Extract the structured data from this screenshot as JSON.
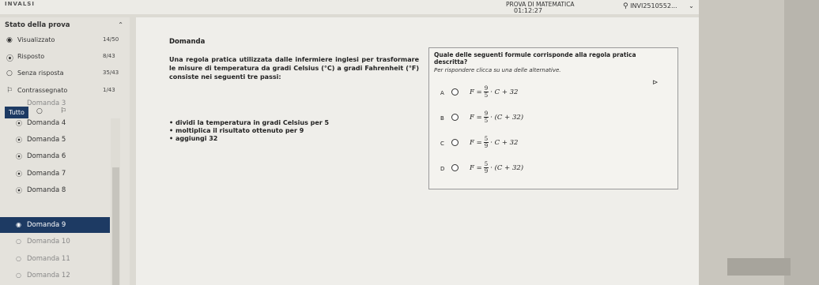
{
  "topbar": {
    "logo": "INVALSI",
    "exam": "PROVA DI MATEMATICA",
    "timer": "01:12:27",
    "user": "INVI2510552..."
  },
  "sidebar": {
    "header": "Stato della prova",
    "stats": [
      {
        "icon": "◉",
        "label": "Visualizzato",
        "count": "14/50"
      },
      {
        "icon": "⦿",
        "label": "Risposto",
        "count": "8/43"
      },
      {
        "icon": "○",
        "label": "Senza risposta",
        "count": "35/43"
      },
      {
        "icon": "⚐",
        "label": "Contrassegnato",
        "count": "1/43"
      }
    ],
    "filter": {
      "all": "Tutto",
      "unanswered": "○",
      "flagged": "⚐"
    },
    "questions": [
      {
        "label": "Domanda 3",
        "icon": "⦿"
      },
      {
        "label": "Domanda 4",
        "icon": "⦿"
      },
      {
        "label": "Domanda 5",
        "icon": "⦿"
      },
      {
        "label": "Domanda 6",
        "icon": "⦿"
      },
      {
        "label": "Domanda 7",
        "icon": "⦿"
      },
      {
        "label": "Domanda 8",
        "icon": "⦿"
      },
      {
        "label": "Domanda 9",
        "icon": "◉"
      },
      {
        "label": "Domanda 10",
        "icon": "○"
      },
      {
        "label": "Domanda 11",
        "icon": "○"
      },
      {
        "label": "Domanda 12",
        "icon": "○"
      }
    ]
  },
  "question": {
    "title": "Domanda",
    "text": "Una regola pratica utilizzata dalle infermiere inglesi per trasformare le misure di temperatura da gradi Celsius (°C) a gradi Fahrenheit (°F) consiste nei seguenti tre passi:",
    "steps": [
      "dividi la temperatura in gradi Celsius per 5",
      "moltiplica il risultato ottenuto per 9",
      "aggiungi 32"
    ]
  },
  "answer": {
    "prompt": "Quale delle seguenti formule corrisponde alla regola pratica descritta?",
    "instruction": "Per rispondere clicca su una delle alternative.",
    "options": [
      {
        "letter": "A",
        "lhs": "F =",
        "num": "9",
        "den": "5",
        "rhs": "· C + 32"
      },
      {
        "letter": "B",
        "lhs": "F =",
        "num": "9",
        "den": "5",
        "rhs": "· (C + 32)"
      },
      {
        "letter": "C",
        "lhs": "F =",
        "num": "5",
        "den": "9",
        "rhs": "· C + 32"
      },
      {
        "letter": "D",
        "lhs": "F =",
        "num": "5",
        "den": "9",
        "rhs": "· (C + 32)"
      }
    ]
  },
  "colors": {
    "accent": "#1d3a63"
  }
}
